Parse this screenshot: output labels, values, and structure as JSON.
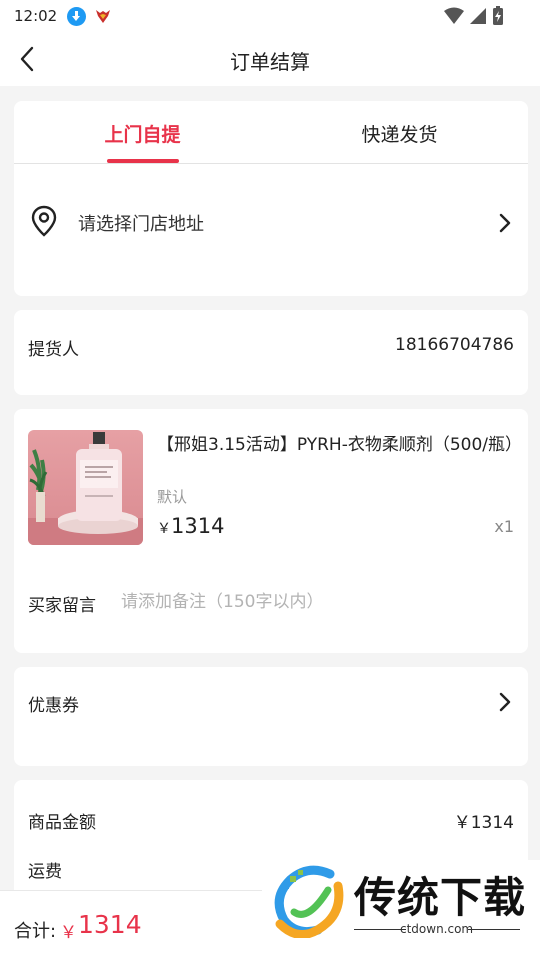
{
  "status_bar": {
    "time": "12:02"
  },
  "nav": {
    "title": "订单结算"
  },
  "delivery": {
    "tabs": [
      {
        "label": "上门自提",
        "active": true
      },
      {
        "label": "快递发货",
        "active": false
      }
    ],
    "address_prompt": "请选择门店地址"
  },
  "pickup": {
    "label": "提货人",
    "phone": "18166704786"
  },
  "product": {
    "title": "【邢姐3.15活动】PYRH-衣物柔顺剂（500/瓶）",
    "spec": "默认",
    "currency": "￥",
    "price": "1314",
    "quantity": "x1"
  },
  "note": {
    "label": "买家留言",
    "placeholder": "请添加备注（150字以内）"
  },
  "coupon": {
    "label": "优惠券"
  },
  "summary": {
    "goods_amount_label": "商品金额",
    "goods_amount_value": "￥1314",
    "shipping_label": "运费"
  },
  "footer": {
    "total_label": "合计:",
    "currency": "￥",
    "total_value": "1314"
  },
  "watermark": {
    "brand": "传统下载",
    "domain": "ctdown.com"
  },
  "colors": {
    "accent": "#e8334a",
    "background": "#f4f4f4",
    "card": "#ffffff"
  }
}
